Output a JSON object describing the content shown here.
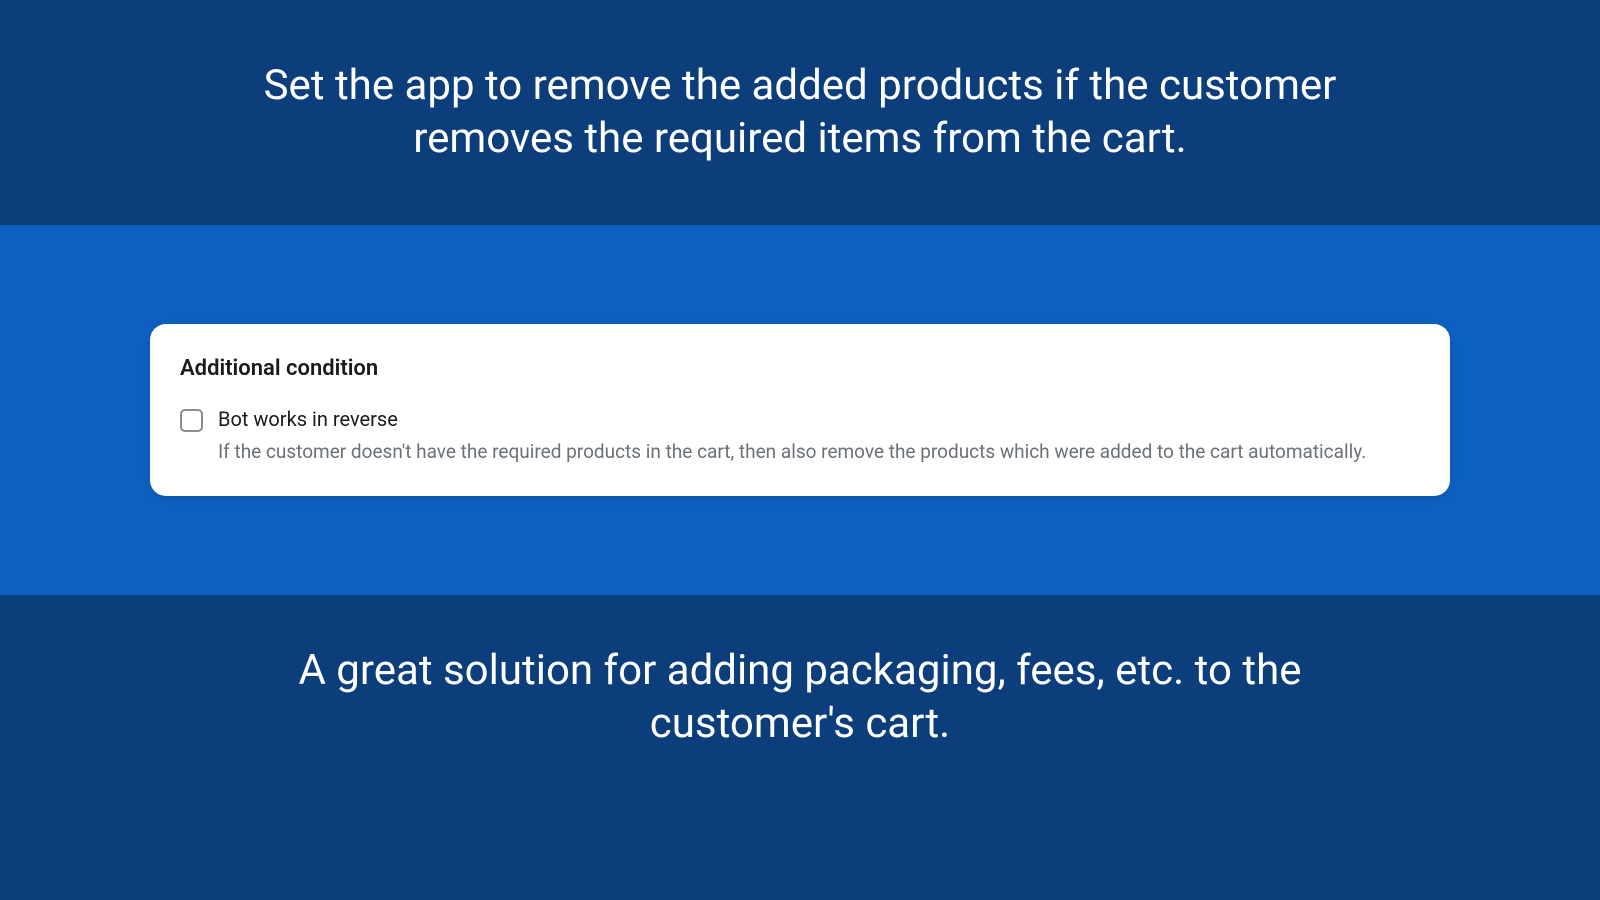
{
  "top": {
    "text": "Set the app to remove the added products if the customer removes the required items from the cart."
  },
  "card": {
    "title": "Additional condition",
    "checkbox": {
      "label": "Bot works in reverse",
      "description": "If the customer doesn't have the required products in the cart, then also remove the products which were added to the cart automatically.",
      "checked": false
    }
  },
  "bottom": {
    "text": "A great solution for adding packaging, fees, etc. to the customer's cart."
  }
}
